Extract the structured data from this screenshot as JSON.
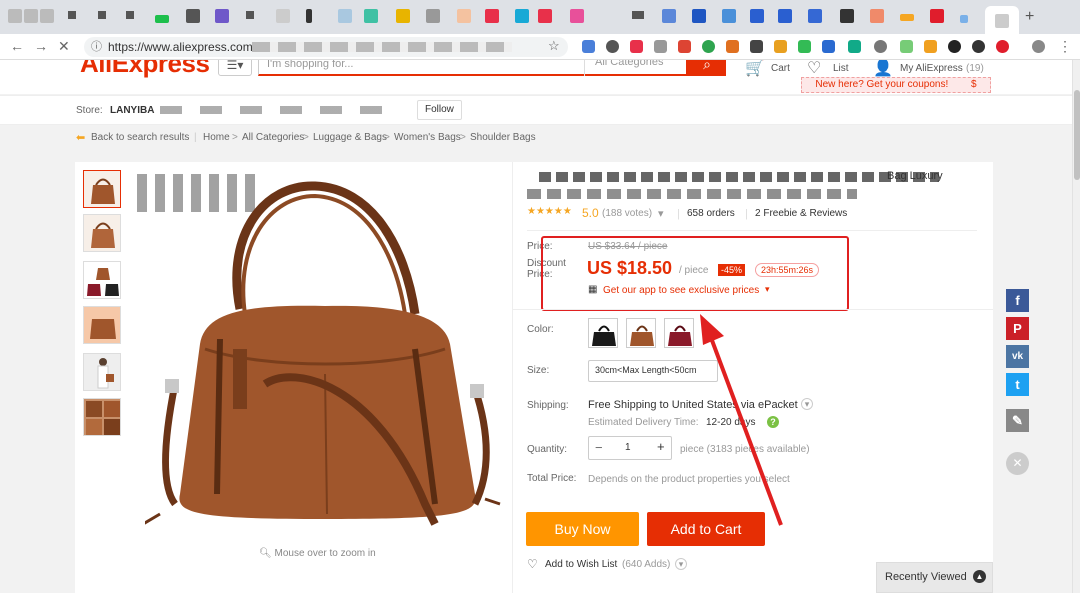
{
  "browser": {
    "url": "https://www.aliexpress.com"
  },
  "header": {
    "logo": "AliExpress",
    "search_placeholder": "I'm shopping for...",
    "category_select": "All Categories",
    "cart_label": "Cart",
    "wishlist_label": "List",
    "account_label": "My AliExpress",
    "account_count": "(19)",
    "coupon_text": "New here? Get your coupons!",
    "coupon_icon": "$"
  },
  "store": {
    "label": "Store:",
    "name": "LANYIBA",
    "follow": "Follow"
  },
  "breadcrumb": {
    "back": "Back to search results",
    "path": [
      "Home",
      "All Categories",
      "Luggage & Bags",
      "Women's Bags",
      "Shoulder Bags"
    ]
  },
  "product": {
    "title_tail": "Bag Luxury",
    "rating": "5.0",
    "votes": "(188 votes)",
    "orders": "658 orders",
    "reviews": "2 Freebie & Reviews",
    "price_label": "Price:",
    "original_price": "US $33.64 / piece",
    "discount_label": "Discount Price:",
    "discount_price": "US $18.50",
    "per_piece": "/ piece",
    "discount_badge": "-45%",
    "countdown": "23h:55m:26s",
    "app_promo": "Get our app to see exclusive prices",
    "color_label": "Color:",
    "size_label": "Size:",
    "size_value": "30cm<Max Length<50cm",
    "shipping_label": "Shipping:",
    "shipping_value": "Free Shipping to United States via ePacket",
    "delivery_label": "Estimated Delivery Time:",
    "delivery_value": "12-20 days",
    "quantity_label": "Quantity:",
    "quantity_value": "1",
    "quantity_note": "piece (3183 pieces available)",
    "total_label": "Total Price:",
    "total_note": "Depends on the product properties you select",
    "buy_now": "Buy Now",
    "add_to_cart": "Add to Cart",
    "wishlist": "Add to Wish List",
    "wishlist_count": "(640 Adds)",
    "zoom_hint": "Mouse over to zoom in"
  },
  "recently_viewed": "Recently Viewed",
  "colors": {
    "accent": "#e62e04",
    "buy_now": "#ff9500",
    "add_to_cart": "#e62e04",
    "highlight_box": "#e02020",
    "bag": "#a0562c"
  }
}
